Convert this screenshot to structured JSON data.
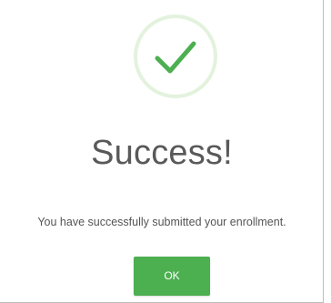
{
  "dialog": {
    "icon": "checkmark-icon",
    "title": "Success!",
    "message": "You have successfully submitted your enrollment.",
    "ok_label": "OK"
  },
  "colors": {
    "accent_green": "#4caf50",
    "icon_ring": "#e3f2dd",
    "title_text": "#595959",
    "message_text": "#545454"
  }
}
